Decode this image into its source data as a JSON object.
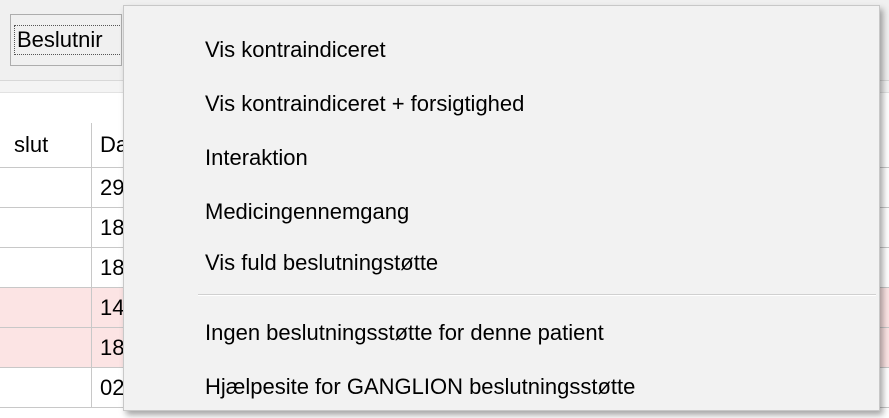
{
  "toolbar": {
    "decision_button_label": "Beslutnir"
  },
  "grid": {
    "columns": [
      "slut",
      "Da"
    ],
    "rows": [
      {
        "col2": "29",
        "highlight": false
      },
      {
        "col2": "18",
        "highlight": false
      },
      {
        "col2": "18",
        "highlight": false
      },
      {
        "col2": "14",
        "highlight": true
      },
      {
        "col2": "18",
        "highlight": true
      },
      {
        "col2": "02",
        "highlight": false
      }
    ],
    "highlight_color": "#fce4e4"
  },
  "context_menu": {
    "items": [
      {
        "label": "Vis kontraindiceret"
      },
      {
        "label": "Vis kontraindiceret + forsigtighed"
      },
      {
        "label": "Interaktion"
      },
      {
        "label": "Medicingennemgang"
      },
      {
        "label": "Vis fuld beslutningstøtte"
      },
      {
        "label": "Ingen beslutningsstøtte for denne patient"
      },
      {
        "label": "Hjælpesite for GANGLION beslutningsstøtte"
      }
    ]
  }
}
